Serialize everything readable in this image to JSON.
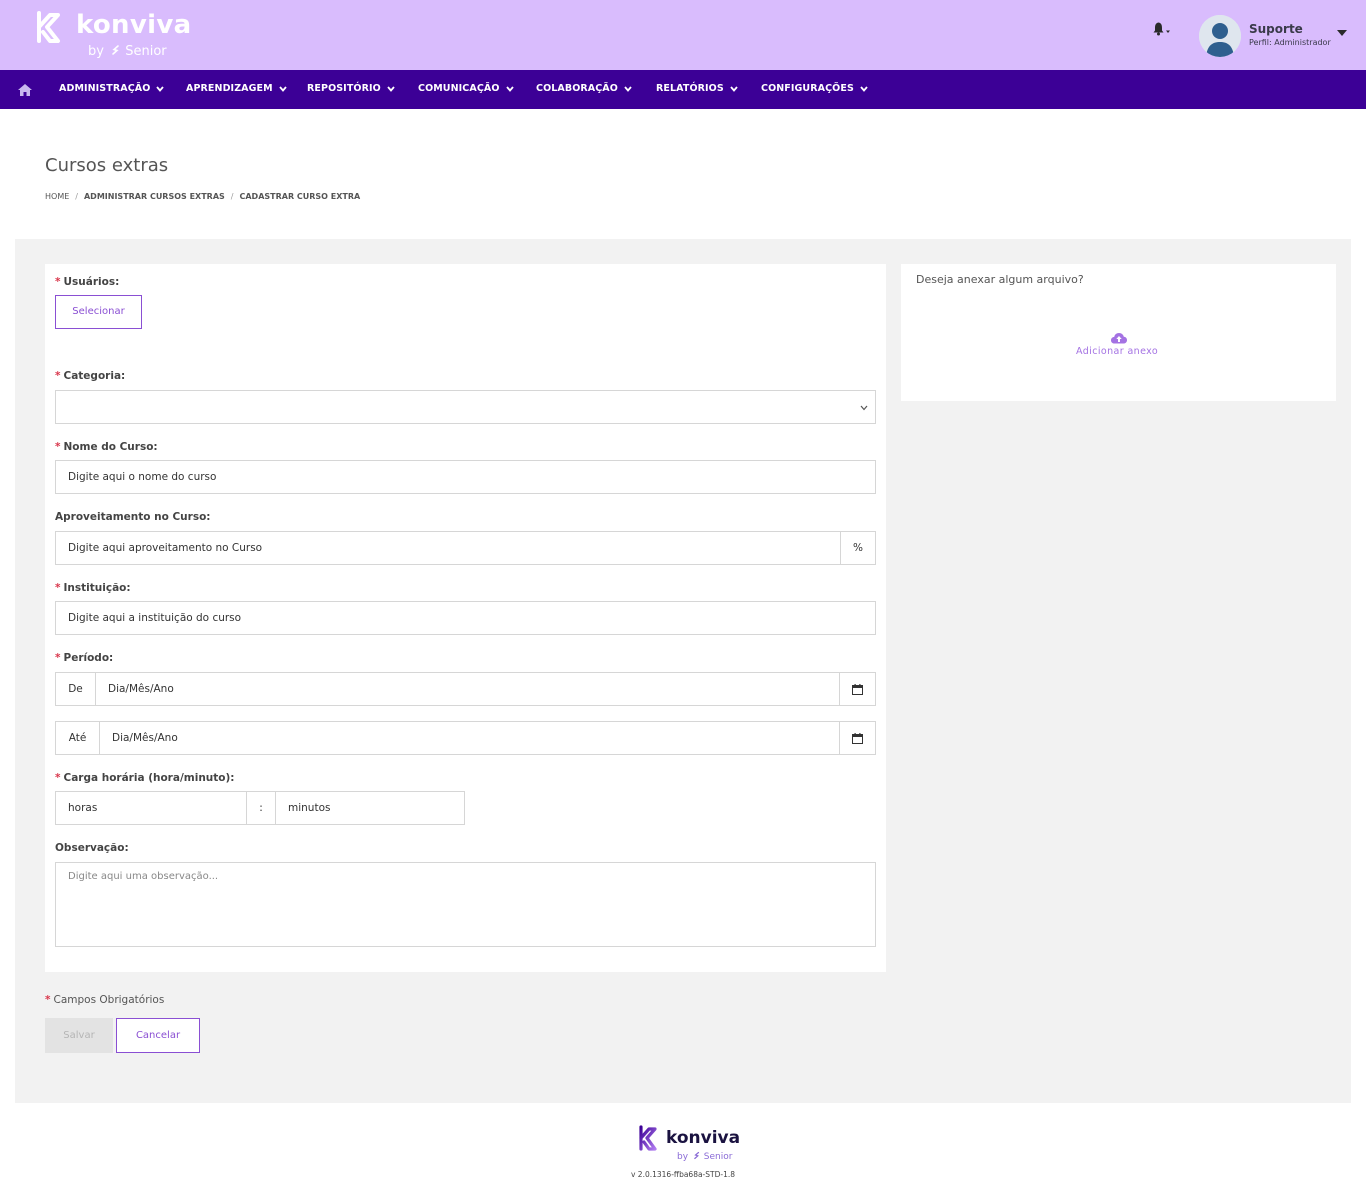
{
  "brand": {
    "name": "konviva",
    "by_prefix": "by",
    "by_company": "Senior",
    "header_bg": "#d9bcfd",
    "nav_bg": "#3c0096",
    "accent": "#8a4fd3"
  },
  "user": {
    "name": "Suporte",
    "role": "Perfil: Administrador"
  },
  "nav": {
    "items": [
      {
        "label": "ADMINISTRAÇÃO"
      },
      {
        "label": "APRENDIZAGEM"
      },
      {
        "label": "REPOSITÓRIO"
      },
      {
        "label": "COMUNICAÇÃO"
      },
      {
        "label": "COLABORAÇÃO"
      },
      {
        "label": "RELATÓRIOS"
      },
      {
        "label": "CONFIGURAÇÕES"
      }
    ]
  },
  "page": {
    "title": "Cursos extras",
    "breadcrumb": [
      "HOME",
      "ADMINISTRAR CURSOS EXTRAS",
      "CADASTRAR CURSO EXTRA"
    ]
  },
  "form": {
    "required_mark": "*",
    "usuarios": {
      "label": "Usuários:",
      "button": "Selecionar"
    },
    "categoria": {
      "label": "Categoria:",
      "value": ""
    },
    "nome_curso": {
      "label": "Nome do Curso:",
      "value": "Digite aqui o nome do curso"
    },
    "aproveitamento": {
      "label": "Aproveitamento no Curso:",
      "value": "Digite aqui aproveitamento no Curso",
      "suffix": "%"
    },
    "instituicao": {
      "label": "Instituição:",
      "value": "Digite aqui a instituição do curso"
    },
    "periodo": {
      "label": "Período:",
      "from_prefix": "De",
      "from_value": "Dia/Mês/Ano",
      "to_prefix": "Até",
      "to_value": "Dia/Mês/Ano"
    },
    "carga": {
      "label": "Carga horária (hora/minuto):",
      "hours": "horas",
      "separator": ":",
      "minutes": "minutos"
    },
    "observacao": {
      "label": "Observação:",
      "placeholder": "Digite aqui uma observação..."
    },
    "required_note": "Campos Obrigatórios",
    "save": "Salvar",
    "cancel": "Cancelar"
  },
  "attachment": {
    "question": "Deseja anexar algum arquivo?",
    "link": "Adicionar anexo",
    "icon": "cloud-upload-icon"
  },
  "footer": {
    "version": "v 2.0.1316-ffba68a-STD-1.8"
  }
}
